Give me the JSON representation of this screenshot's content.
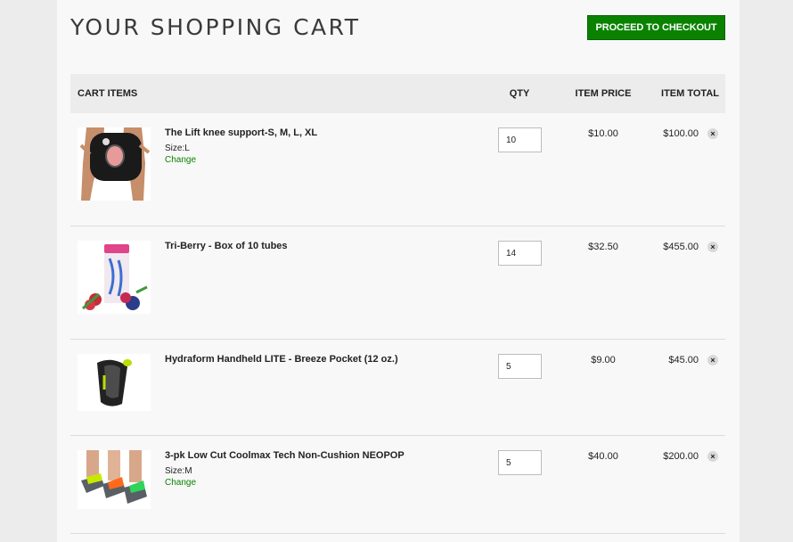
{
  "page": {
    "title": "YOUR SHOPPING CART",
    "checkout_label": "PROCEED TO CHECKOUT"
  },
  "columns": {
    "items": "CART ITEMS",
    "qty": "QTY",
    "price": "ITEM PRICE",
    "total": "ITEM TOTAL"
  },
  "items": [
    {
      "name": "The Lift knee support-S, M, L, XL",
      "size": "Size:L",
      "change": "Change",
      "qty": "10",
      "price": "$10.00",
      "total": "$100.00",
      "remove": "×",
      "image": "knee-support-image"
    },
    {
      "name": "Tri-Berry - Box of 10 tubes",
      "qty": "14",
      "price": "$32.50",
      "total": "$455.00",
      "remove": "×",
      "image": "tri-berry-tube-image"
    },
    {
      "name": "Hydraform Handheld LITE - Breeze Pocket (12 oz.)",
      "qty": "5",
      "price": "$9.00",
      "total": "$45.00",
      "remove": "×",
      "image": "handheld-bottle-image"
    },
    {
      "name": "3-pk Low Cut Coolmax Tech Non-Cushion NEOPOP",
      "size": "Size:M",
      "change": "Change",
      "qty": "5",
      "price": "$40.00",
      "total": "$200.00",
      "remove": "×",
      "image": "socks-image"
    }
  ],
  "colors": {
    "accent": "#0a8200",
    "header_bg": "#ececec"
  }
}
